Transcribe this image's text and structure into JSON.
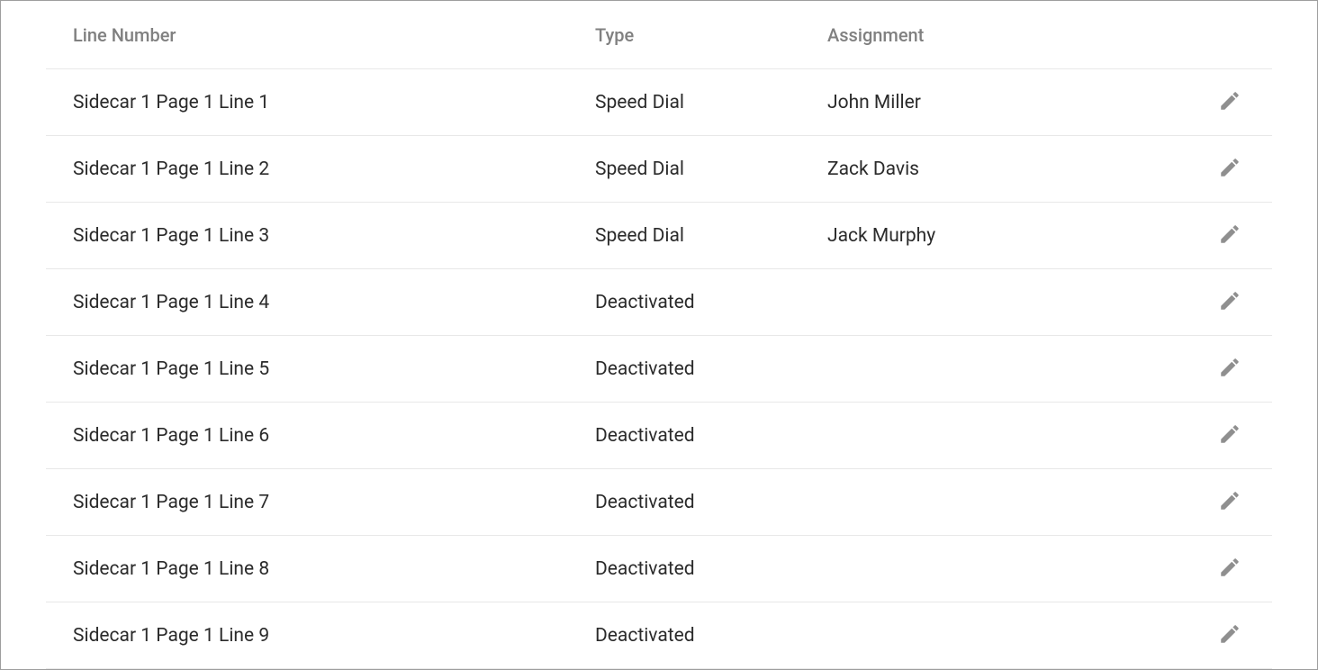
{
  "table": {
    "headers": {
      "line_number": "Line Number",
      "type": "Type",
      "assignment": "Assignment"
    },
    "rows": [
      {
        "line_number": "Sidecar 1 Page 1 Line 1",
        "type": "Speed Dial",
        "assignment": "John Miller"
      },
      {
        "line_number": "Sidecar 1 Page 1 Line 2",
        "type": "Speed Dial",
        "assignment": "Zack Davis"
      },
      {
        "line_number": "Sidecar 1 Page 1 Line 3",
        "type": "Speed Dial",
        "assignment": "Jack Murphy"
      },
      {
        "line_number": "Sidecar 1 Page 1 Line 4",
        "type": "Deactivated",
        "assignment": ""
      },
      {
        "line_number": "Sidecar 1 Page 1 Line 5",
        "type": "Deactivated",
        "assignment": ""
      },
      {
        "line_number": "Sidecar 1 Page 1 Line 6",
        "type": "Deactivated",
        "assignment": ""
      },
      {
        "line_number": "Sidecar 1 Page 1 Line 7",
        "type": "Deactivated",
        "assignment": ""
      },
      {
        "line_number": "Sidecar 1 Page 1 Line 8",
        "type": "Deactivated",
        "assignment": ""
      },
      {
        "line_number": "Sidecar 1 Page 1 Line 9",
        "type": "Deactivated",
        "assignment": ""
      }
    ]
  }
}
